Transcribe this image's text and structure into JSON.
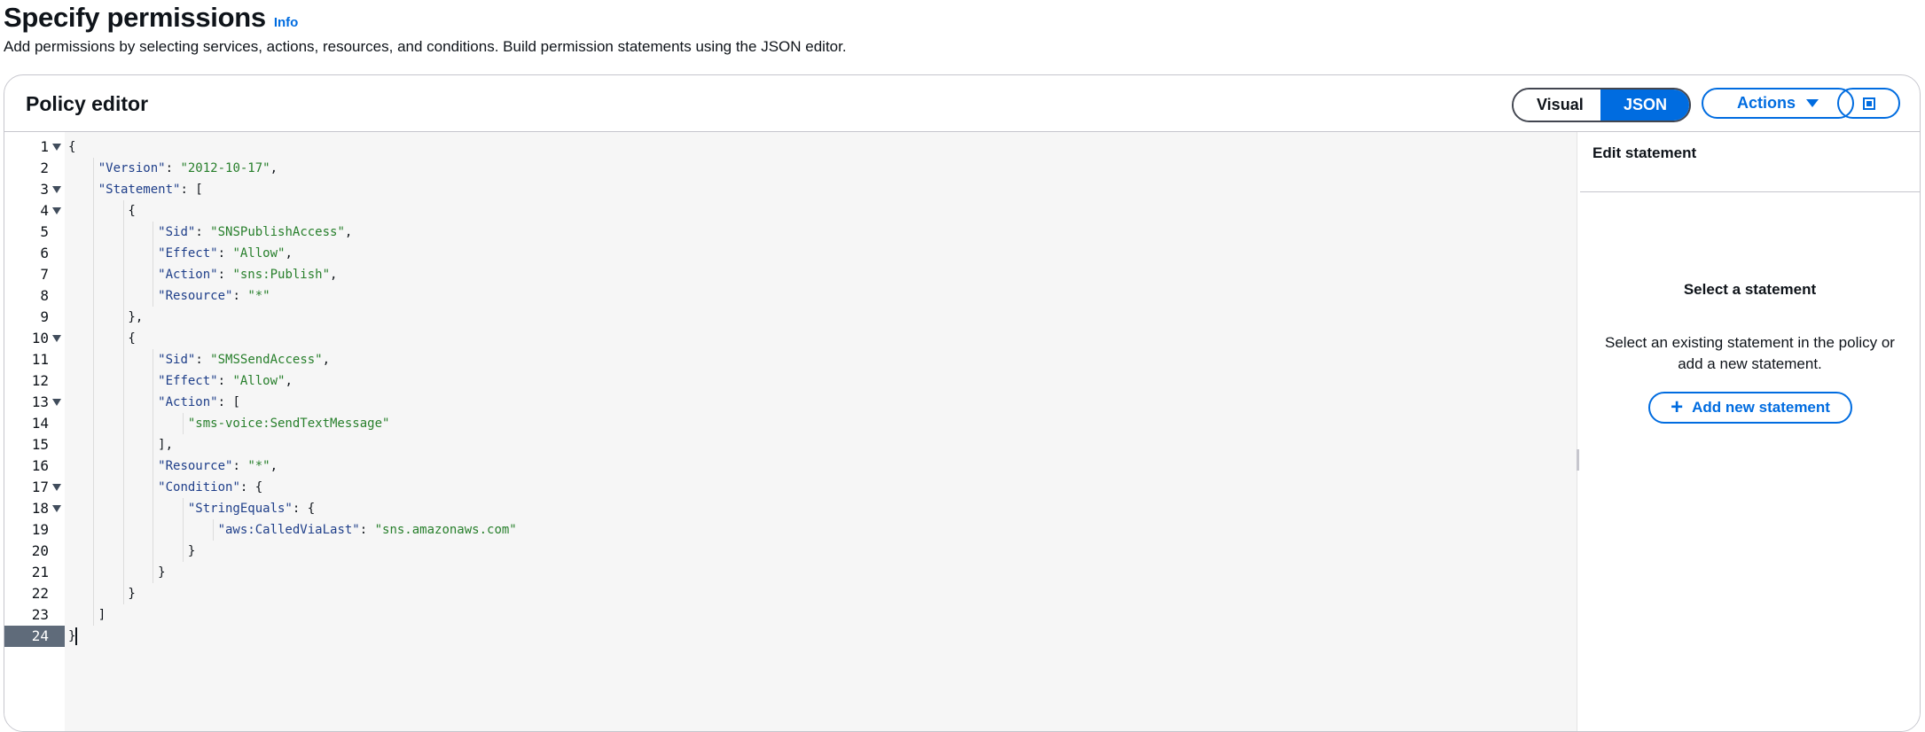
{
  "header": {
    "title": "Specify permissions",
    "info": "Info",
    "description": "Add permissions by selecting services, actions, resources, and conditions. Build permission statements using the JSON editor."
  },
  "editor": {
    "title": "Policy editor",
    "mode_visual": "Visual",
    "mode_json": "JSON",
    "selected_mode": "JSON",
    "actions_label": "Actions",
    "split_icon": "split-panel-icon",
    "active_line": 24,
    "fold_lines": [
      1,
      3,
      4,
      10,
      13,
      17,
      18
    ],
    "lines": [
      "{",
      "    \"Version\": \"2012-10-17\",",
      "    \"Statement\": [",
      "        {",
      "            \"Sid\": \"SNSPublishAccess\",",
      "            \"Effect\": \"Allow\",",
      "            \"Action\": \"sns:Publish\",",
      "            \"Resource\": \"*\"",
      "        },",
      "        {",
      "            \"Sid\": \"SMSSendAccess\",",
      "            \"Effect\": \"Allow\",",
      "            \"Action\": [",
      "                \"sms-voice:SendTextMessage\"",
      "            ],",
      "            \"Resource\": \"*\",",
      "            \"Condition\": {",
      "                \"StringEquals\": {",
      "                    \"aws:CalledViaLast\": \"sns.amazonaws.com\"",
      "                }",
      "            }",
      "        }",
      "    ]",
      "}"
    ]
  },
  "side_panel": {
    "title": "Edit statement",
    "empty_title": "Select a statement",
    "empty_desc": "Select an existing statement in the policy or add a new statement.",
    "add_label": "Add new statement"
  },
  "colors": {
    "accent": "#006ce0",
    "json_key": "#1f3f8a",
    "json_string": "#277f2b"
  }
}
